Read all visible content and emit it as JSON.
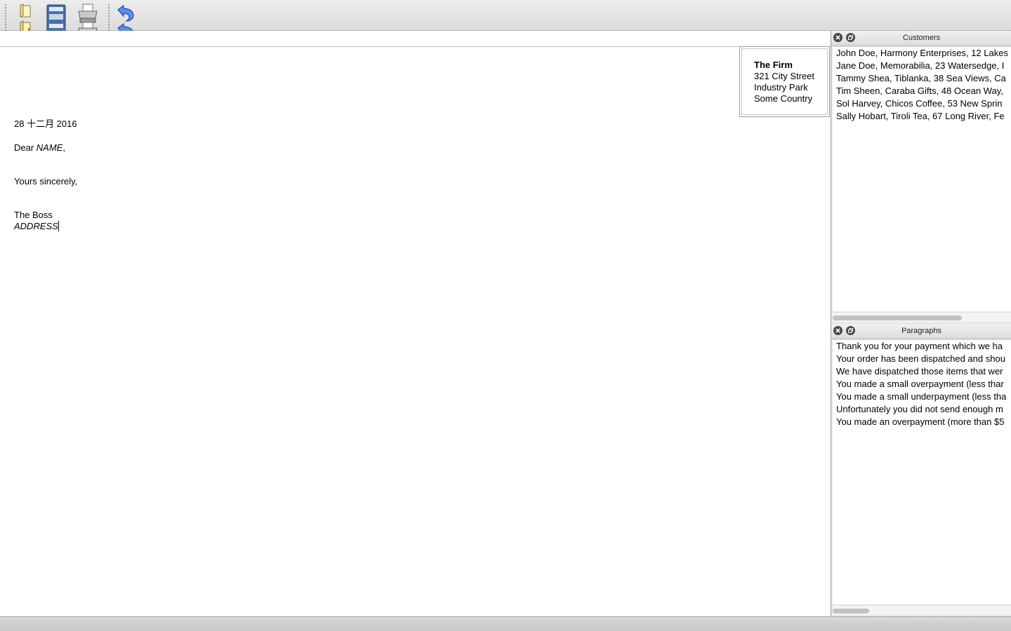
{
  "toolbar": {
    "buttons": [
      {
        "icon": "new-document-icon"
      },
      {
        "icon": "save-icon"
      },
      {
        "icon": "print-icon"
      },
      {
        "icon": "undo-icon"
      }
    ]
  },
  "letter": {
    "firm": {
      "name": "The Firm",
      "street": "321 City Street",
      "area": "Industry Park",
      "country": "Some Country"
    },
    "date": "28 十二月 2016",
    "salutation_prefix": "Dear ",
    "salutation_name": "NAME",
    "salutation_suffix": ",",
    "closing": "Yours sincerely,",
    "signer": "The Boss",
    "signer_address": "ADDRESS"
  },
  "customers_panel": {
    "title": "Customers",
    "rows": [
      "John Doe, Harmony Enterprises, 12 Lakes",
      "Jane Doe, Memorabilia, 23 Watersedge, I",
      "Tammy Shea, Tiblanka, 38 Sea Views, Ca",
      "Tim Sheen, Caraba Gifts, 48 Ocean Way,",
      "Sol Harvey, Chicos Coffee, 53 New Sprin",
      "Sally Hobart, Tiroli Tea, 67 Long River, Fe"
    ]
  },
  "paragraphs_panel": {
    "title": "Paragraphs",
    "rows": [
      "Thank you for your payment which we ha",
      "Your order has been dispatched and shou",
      "We have dispatched those items that wer",
      "You made a small overpayment (less thar",
      "You made a small underpayment (less tha",
      "Unfortunately you did not send enough m",
      "You made an overpayment (more than $5"
    ]
  },
  "colors": {
    "undo_blue": "#4a7de0",
    "toolbar_bg": "#e3e3e3"
  }
}
